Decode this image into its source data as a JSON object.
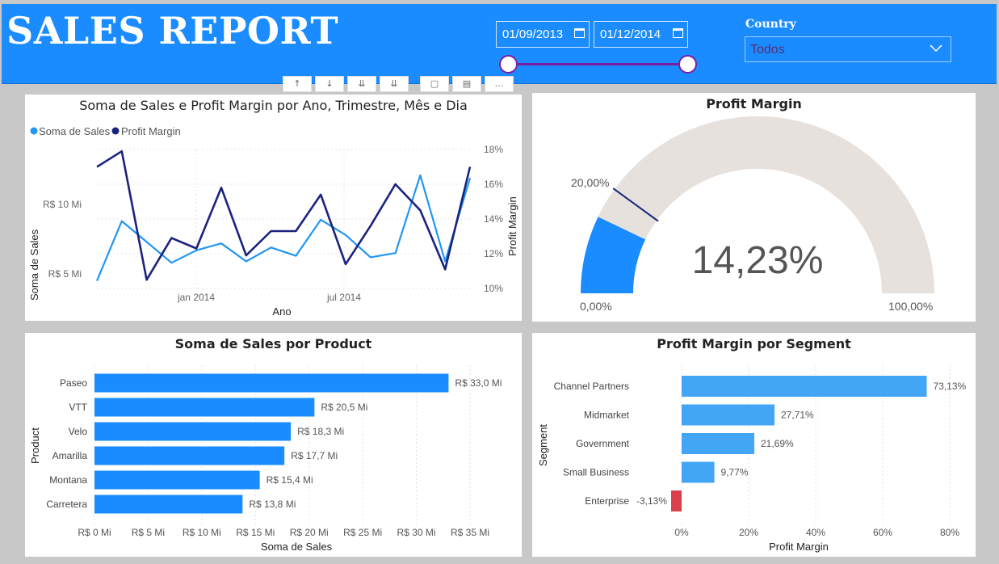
{
  "header": {
    "title": "SALES REPORT",
    "date_start": "01/09/2013",
    "date_end": "01/12/2014",
    "country_label": "Country",
    "country_value": "Todos",
    "accent_color": "#1a8cff",
    "slider_color": "#7a1fa2"
  },
  "toolbar": {
    "icons": [
      "up-arrow-icon",
      "down-arrow-icon",
      "double-down-icon",
      "expand-down-icon",
      "focus-icon",
      "table-icon",
      "more-icon"
    ]
  },
  "line_panel": {
    "title": "Soma de Sales e Profit Margin por Ano, Trimestre, Mês e Dia",
    "legend": [
      "Soma de  Sales",
      "Profit Margin"
    ],
    "legend_colors": [
      "#2196f3",
      "#1a237e"
    ],
    "xlabel": "Ano",
    "ylabel_left": "Soma de Sales",
    "ylabel_right": "Profit Margin"
  },
  "gauge_panel": {
    "title": "Profit Margin",
    "value_label": "14,23%",
    "min_label": "0,00%",
    "max_label": "100,00%",
    "target_label": "20,00%"
  },
  "product_panel": {
    "title": "Soma de Sales por Product",
    "xlabel": "Soma de Sales",
    "ylabel": "Product"
  },
  "segment_panel": {
    "title": "Profit Margin por Segment",
    "xlabel": "Profit Margin",
    "ylabel": "Segment"
  },
  "chart_data": [
    {
      "type": "line",
      "title": "Soma de Sales e Profit Margin por Ano, Trimestre, Mês e Dia",
      "xlabel": "Ano",
      "x_ticks": [
        "jan 2014",
        "jul 2014"
      ],
      "y_left_ticks": [
        "R$ 5 Mi",
        "R$ 10 Mi"
      ],
      "y_right_ticks": [
        "10%",
        "12%",
        "14%",
        "16%",
        "18%"
      ],
      "ylim_left": [
        4.5,
        12.5
      ],
      "ylim_right": [
        10,
        18
      ],
      "series": [
        {
          "name": "Soma de  Sales",
          "axis": "left",
          "color": "#2196f3",
          "values": [
            4.5,
            8.8,
            7.3,
            5.8,
            6.7,
            7.2,
            5.9,
            6.9,
            6.3,
            8.9,
            7.8,
            6.2,
            6.5,
            12.1,
            5.9,
            11.9
          ]
        },
        {
          "name": "Profit Margin",
          "axis": "right",
          "color": "#1a237e",
          "values": [
            17.0,
            17.9,
            10.5,
            12.9,
            12.3,
            15.8,
            11.9,
            13.3,
            13.3,
            15.4,
            11.4,
            13.6,
            16.0,
            14.5,
            11.1,
            17.0
          ]
        }
      ]
    },
    {
      "type": "gauge",
      "title": "Profit Margin",
      "value": 14.23,
      "min": 0,
      "max": 100,
      "target": 20,
      "fill_color": "#1a8cff",
      "track_color": "#e6e1dd"
    },
    {
      "type": "bar",
      "orientation": "horizontal",
      "title": "Soma de Sales por Product",
      "categories": [
        "Paseo",
        "VTT",
        "Velo",
        "Amarilla",
        "Montana",
        "Carretera"
      ],
      "values": [
        33.0,
        20.5,
        18.3,
        17.7,
        15.4,
        13.8
      ],
      "data_labels": [
        "R$ 33,0 Mi",
        "R$ 20,5 Mi",
        "R$ 18,3 Mi",
        "R$ 17,7 Mi",
        "R$ 15,4 Mi",
        "R$ 13,8 Mi"
      ],
      "x_ticks": [
        "R$ 0 Mi",
        "R$ 5 Mi",
        "R$ 10 Mi",
        "R$ 15 Mi",
        "R$ 20 Mi",
        "R$ 25 Mi",
        "R$ 30 Mi",
        "R$ 35 Mi"
      ],
      "xlim": [
        0,
        35
      ],
      "xlabel": "Soma de Sales",
      "ylabel": "Product",
      "color": "#1a8cff"
    },
    {
      "type": "bar",
      "orientation": "horizontal",
      "title": "Profit Margin por Segment",
      "categories": [
        "Channel Partners",
        "Midmarket",
        "Government",
        "Small Business",
        "Enterprise"
      ],
      "values": [
        73.13,
        27.71,
        21.69,
        9.77,
        -3.13
      ],
      "data_labels": [
        "73,13%",
        "27,71%",
        "21,69%",
        "9,77%",
        "-3,13%"
      ],
      "x_ticks": [
        "0%",
        "20%",
        "40%",
        "60%",
        "80%"
      ],
      "xlim": [
        0,
        80
      ],
      "xlabel": "Profit Margin",
      "ylabel": "Segment",
      "color": "#42a5f5",
      "negative_color": "#d9404b"
    }
  ]
}
